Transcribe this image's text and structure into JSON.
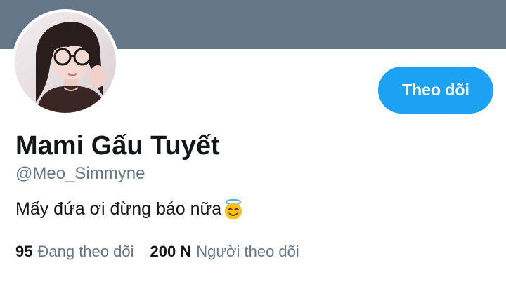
{
  "profile": {
    "display_name": "Mami Gấu Tuyết",
    "handle": "@Meo_Simmyne",
    "bio": "Mấy đứa ơi đừng báo nữa",
    "bio_emoji": "smiling-face-with-halo-icon"
  },
  "actions": {
    "follow_label": "Theo dõi"
  },
  "stats": {
    "following_count": "95",
    "following_label": "Đang theo dõi",
    "followers_count": "200 N",
    "followers_label": "Người theo dõi"
  },
  "colors": {
    "banner": "#66778a",
    "accent": "#1da1f2",
    "text_primary": "#14171a",
    "text_secondary": "#657786"
  }
}
